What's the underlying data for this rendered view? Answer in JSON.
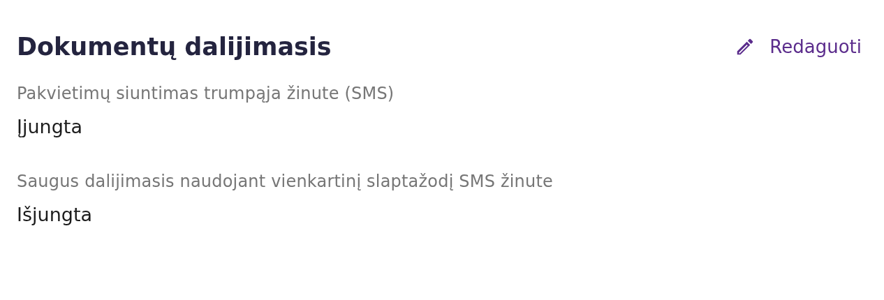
{
  "section": {
    "title": "Dokumentų dalijimasis",
    "edit_button": "Redaguoti"
  },
  "settings": [
    {
      "label": "Pakvietimų siuntimas trumpąja žinute (SMS)",
      "value": "Įjungta"
    },
    {
      "label": "Saugus dalijimasis naudojant vienkartinį slaptažodį SMS žinute",
      "value": "Išjungta"
    }
  ]
}
